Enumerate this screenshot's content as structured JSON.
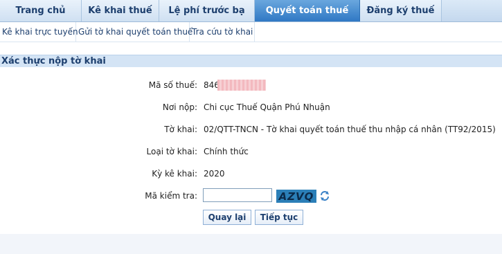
{
  "tabs": [
    {
      "label": "Trang chủ"
    },
    {
      "label": "Kê khai thuế"
    },
    {
      "label": "Lệ phí trước bạ"
    },
    {
      "label": "Quyết toán thuế",
      "active": true
    },
    {
      "label": "Đăng ký thuế"
    }
  ],
  "submenu": [
    {
      "label": "Kê khai trực tuyến"
    },
    {
      "label": "Gửi tờ khai quyết toán thuế"
    },
    {
      "label": "Tra cứu tờ khai"
    }
  ],
  "section": {
    "title": "Xác thực nộp tờ khai"
  },
  "form": {
    "tax_code_label": "Mã số thuế:",
    "tax_code_value": "846",
    "place_label": "Nơi nộp:",
    "place_value": "Chi cục Thuế Quận Phú Nhuận",
    "declaration_label": "Tờ khai:",
    "declaration_value": "02/QTT-TNCN - Tờ khai quyết toán thuế thu nhập cá nhân (TT92/2015)",
    "type_label": "Loại tờ khai:",
    "type_value": "Chính thức",
    "period_label": "Kỳ kê khai:",
    "period_value": "2020",
    "captcha_label": "Mã kiểm tra:",
    "captcha_input_value": "",
    "captcha_text": "AZVQ",
    "back_button": "Quay lại",
    "next_button": "Tiếp tục"
  },
  "icons": {
    "refresh": "refresh-icon"
  },
  "colors": {
    "active_tab": "#2f78c4",
    "section_bg": "#d4e4f5",
    "captcha_bg": "#2b7fb8",
    "text_link": "#1d3f6e"
  }
}
